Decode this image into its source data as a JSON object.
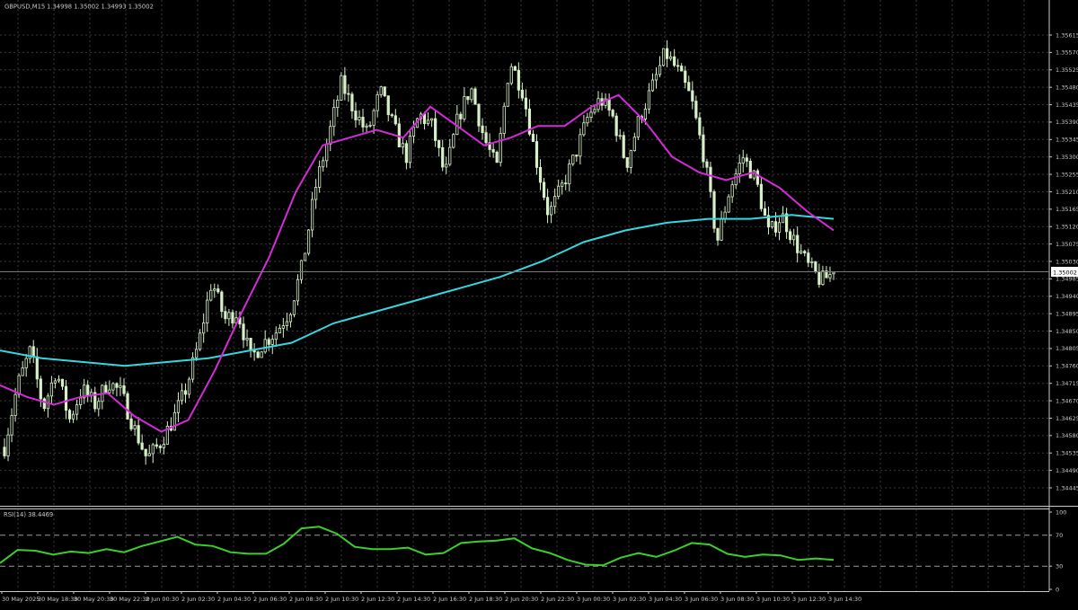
{
  "window": {
    "symbol_header": "GBPUSD,M15",
    "ohlc_values": "1.34998 1.35002 1.34993 1.35002",
    "bid_label": "1.35002"
  },
  "price_axis": {
    "ticks": [
      "1.35615",
      "1.35570",
      "1.35525",
      "1.35480",
      "1.35435",
      "1.35390",
      "1.35345",
      "1.35300",
      "1.35255",
      "1.35210",
      "1.35165",
      "1.35120",
      "1.35075",
      "1.35030",
      "1.34985",
      "1.34940",
      "1.34895",
      "1.34850",
      "1.34805",
      "1.34760",
      "1.34715",
      "1.34670",
      "1.34625",
      "1.34580",
      "1.34535",
      "1.34490",
      "1.34445"
    ]
  },
  "rsi": {
    "header": "RSI(14) 38.4469",
    "ticks": [
      "100",
      "70",
      "30",
      "0"
    ]
  },
  "time_axis": {
    "labels": [
      "30 May 2025",
      "30 May 18:30",
      "30 May 20:30",
      "30 May 22:30",
      "2 Jun 00:30",
      "2 Jun 02:30",
      "2 Jun 04:30",
      "2 Jun 06:30",
      "2 Jun 08:30",
      "2 Jun 10:30",
      "2 Jun 12:30",
      "2 Jun 14:30",
      "2 Jun 16:30",
      "2 Jun 18:30",
      "2 Jun 20:30",
      "2 Jun 22:30",
      "3 Jun 00:30",
      "3 Jun 02:30",
      "3 Jun 04:30",
      "3 Jun 06:30",
      "3 Jun 08:30",
      "3 Jun 10:30",
      "3 Jun 12:30",
      "3 Jun 14:30"
    ]
  },
  "colors": {
    "background": "#000000",
    "grid": "#3a3a3a",
    "candle": "#d8f0c8",
    "ma_fast": "#d42ad8",
    "ma_slow": "#36d6e0",
    "rsi_line": "#3ccf2a",
    "text": "#c8c8c8"
  },
  "chart_data": [
    {
      "type": "candlestick",
      "symbol": "GBPUSD",
      "timeframe": "M15",
      "ylim": [
        1.34445,
        1.35615
      ],
      "close_path": [
        1.3455,
        1.3471,
        1.348,
        1.3465,
        1.3475,
        1.3462,
        1.347,
        1.3466,
        1.3472,
        1.3469,
        1.346,
        1.3452,
        1.3456,
        1.3462,
        1.347,
        1.3482,
        1.3498,
        1.3488,
        1.349,
        1.3478,
        1.3482,
        1.3485,
        1.349,
        1.3502,
        1.3522,
        1.3535,
        1.3549,
        1.3542,
        1.3536,
        1.3547,
        1.3538,
        1.353,
        1.3541,
        1.3538,
        1.3525,
        1.354,
        1.3548,
        1.3535,
        1.3527,
        1.3555,
        1.3547,
        1.353,
        1.3515,
        1.3522,
        1.353,
        1.354,
        1.3545,
        1.354,
        1.3528,
        1.354,
        1.3548,
        1.3557,
        1.3552,
        1.3545,
        1.353,
        1.3508,
        1.3522,
        1.353,
        1.3524,
        1.351,
        1.3515,
        1.3508,
        1.3502,
        1.3498,
        1.35
      ],
      "ma_fast_path": [
        1.3471,
        1.3468,
        1.3466,
        1.3468,
        1.3469,
        1.3463,
        1.3459,
        1.3462,
        1.3475,
        1.349,
        1.3504,
        1.3521,
        1.3533,
        1.3535,
        1.3537,
        1.3535,
        1.3543,
        1.3538,
        1.3533,
        1.3535,
        1.3538,
        1.3538,
        1.3543,
        1.3546,
        1.3539,
        1.353,
        1.3526,
        1.3524,
        1.3526,
        1.3522,
        1.3516,
        1.3511
      ],
      "ma_slow_path": [
        1.348,
        1.3478,
        1.3477,
        1.3476,
        1.3477,
        1.3478,
        1.348,
        1.3482,
        1.3487,
        1.349,
        1.3493,
        1.3496,
        1.3499,
        1.3503,
        1.3508,
        1.3511,
        1.3513,
        1.3514,
        1.3514,
        1.3515,
        1.3514
      ]
    },
    {
      "type": "line",
      "name": "RSI(14)",
      "ylim": [
        0,
        100
      ],
      "levels": [
        70,
        30
      ],
      "values": [
        34,
        51,
        50,
        45,
        49,
        47,
        52,
        48,
        56,
        62,
        68,
        58,
        56,
        48,
        46,
        46,
        59,
        79,
        81,
        72,
        55,
        52,
        52,
        54,
        45,
        47,
        60,
        62,
        63,
        66,
        53,
        47,
        38,
        32,
        31,
        41,
        47,
        42,
        50,
        60,
        58,
        46,
        42,
        45,
        44,
        38,
        40,
        38
      ]
    }
  ]
}
